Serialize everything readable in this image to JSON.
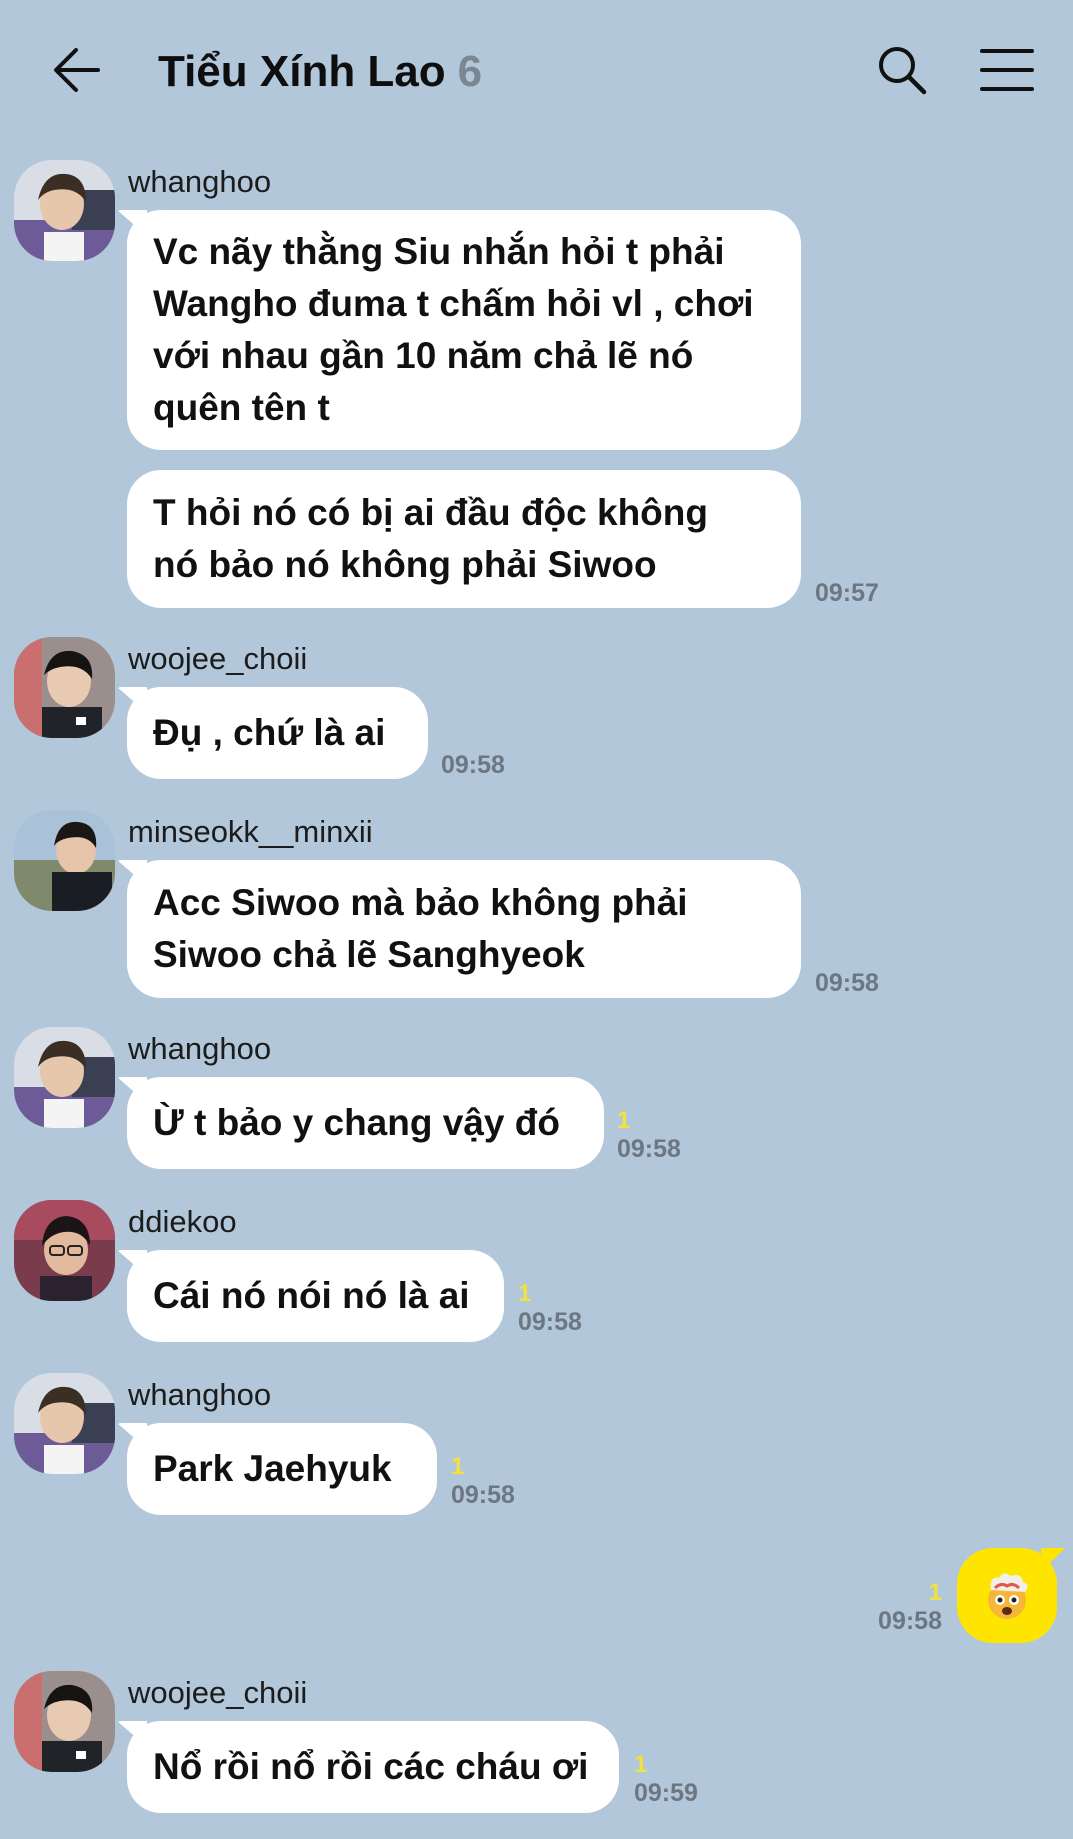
{
  "header": {
    "back_icon": "arrow-left-icon",
    "title": "Tiểu Xính Lao",
    "member_count": "6",
    "search_icon": "search-icon",
    "menu_icon": "hamburger-menu-icon"
  },
  "colors": {
    "background": "#b2c7da",
    "bubble_incoming": "#ffffff",
    "bubble_outgoing": "#fee500",
    "unread_count": "#f2e23c",
    "timestamp": "#6d7782"
  },
  "messages": [
    {
      "sender": "whanghoo",
      "text": "Vc nãy thằng Siu nhắn hỏi t phải\nWangho đuma t chấm hỏi vl , chơi\nvới nhau gần 10 năm chả lẽ nó\nquên tên t"
    },
    {
      "text": "T hỏi nó có bị ai đầu độc không\nnó bảo nó không phải Siwoo",
      "time": "09:57"
    },
    {
      "sender": "woojee_choii",
      "text": "Đụ , chứ là ai",
      "time": "09:58"
    },
    {
      "sender": "minseokk__minxii",
      "text": "Acc Siwoo mà bảo không phải\nSiwoo chả lẽ Sanghyeok",
      "time": "09:58"
    },
    {
      "sender": "whanghoo",
      "text": "Ừ t bảo y chang vậy đó",
      "unread": "1",
      "time": "09:58"
    },
    {
      "sender": "ddiekoo",
      "text": "Cái nó nói nó là ai",
      "unread": "1",
      "time": "09:58"
    },
    {
      "sender": "whanghoo",
      "text": "Park Jaehyuk",
      "unread": "1",
      "time": "09:58"
    },
    {
      "sender": "me",
      "emoji": "exploding-head-emoji",
      "unread": "1",
      "time": "09:58"
    },
    {
      "sender": "woojee_choii",
      "text": "Nổ rồi nổ rồi các cháu ơi",
      "unread": "1",
      "time": "09:59"
    }
  ]
}
